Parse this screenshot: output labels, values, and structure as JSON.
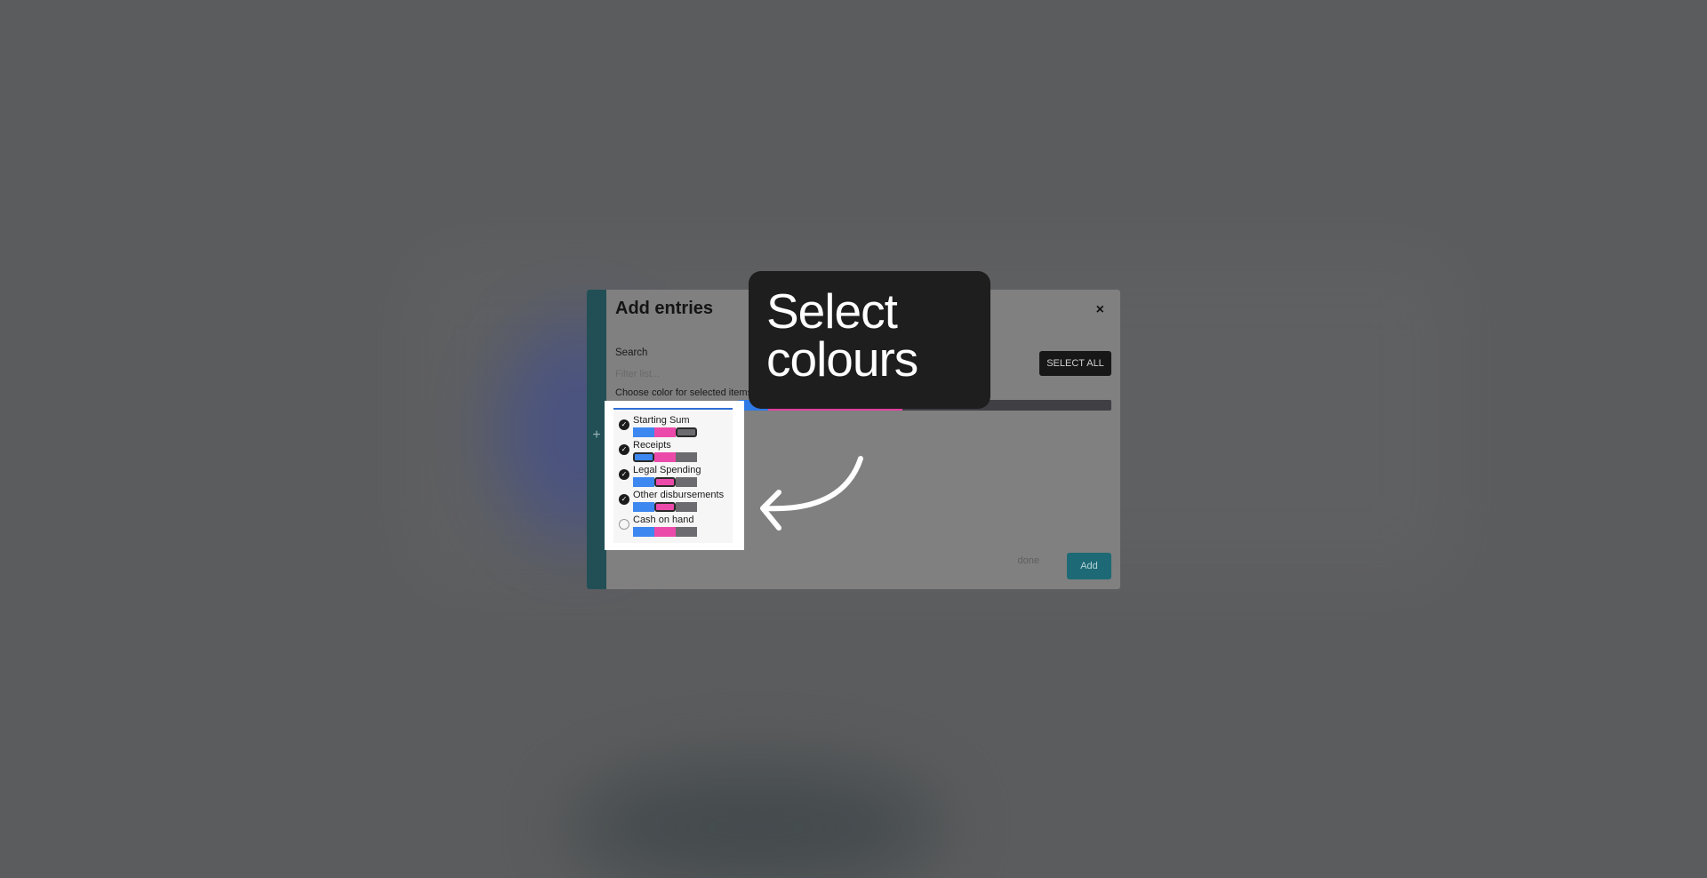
{
  "dialog": {
    "title": "Add entries",
    "close_label": "×",
    "search_label": "Search",
    "search_placeholder": "Filter list...",
    "select_all_label": "SELECT ALL",
    "color_label": "Choose color for selected items",
    "done_label": "done",
    "add_label": "Add",
    "strip_plus": "+"
  },
  "color_bar": [
    "#2f7ae5",
    "#e23e9e",
    "#3f3f44"
  ],
  "swatch_colors": [
    "#3d87f0",
    "#ec4aaa",
    "#6c6c70"
  ],
  "entries": [
    {
      "label": "Starting Sum",
      "checked": true,
      "selected_swatch": 2
    },
    {
      "label": "Receipts",
      "checked": true,
      "selected_swatch": 0
    },
    {
      "label": "Legal Spending",
      "checked": true,
      "selected_swatch": 1
    },
    {
      "label": "Other disbursements",
      "checked": true,
      "selected_swatch": 1
    },
    {
      "label": "Cash on hand",
      "checked": false,
      "selected_swatch": -1
    }
  ],
  "callout": {
    "text": "Select colours"
  }
}
